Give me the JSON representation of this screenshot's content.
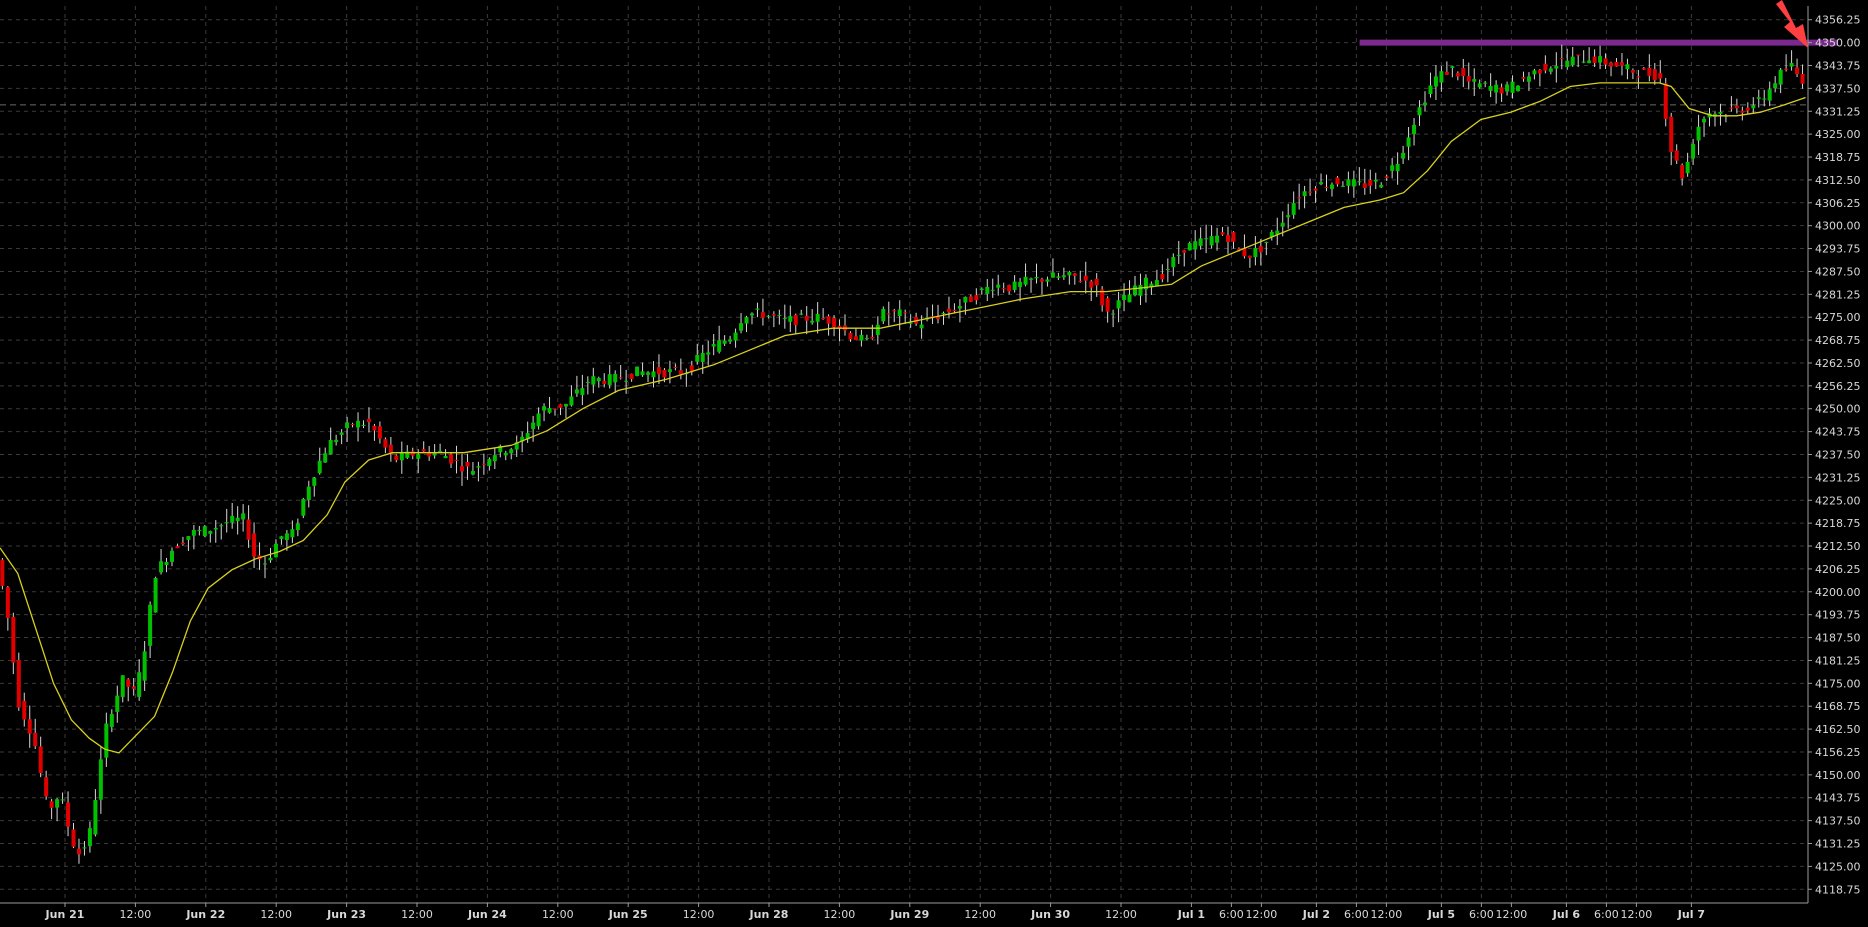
{
  "colors": {
    "background": "#000000",
    "grid": "#3a3a3a",
    "axis": "#9a9a9a",
    "text": "#d8d8d8",
    "up": "#00c000",
    "down": "#e00000",
    "wick": "#d8d8d8",
    "ma": "#d8d020",
    "resistance": "#7a2a8c",
    "arrow": "#ff4040"
  },
  "chart_data": {
    "type": "candlestick",
    "title": "",
    "xlabel": "",
    "ylabel": "",
    "ylim": [
      4115,
      4360
    ],
    "y_ticks": [
      "4356.25",
      "4350.00",
      "4343.75",
      "4337.50",
      "4331.25",
      "4325.00",
      "4318.75",
      "4312.50",
      "4306.25",
      "4300.00",
      "4293.75",
      "4287.50",
      "4281.25",
      "4275.00",
      "4268.75",
      "4262.50",
      "4256.25",
      "4250.00",
      "4243.75",
      "4237.50",
      "4231.25",
      "4225.00",
      "4218.75",
      "4212.50",
      "4206.25",
      "4200.00",
      "4193.75",
      "4187.50",
      "4181.25",
      "4175.00",
      "4168.75",
      "4162.50",
      "4156.25",
      "4150.00",
      "4143.75",
      "4137.50",
      "4131.25",
      "4125.00",
      "4118.75"
    ],
    "x_labels": [
      {
        "t": "Jun 21",
        "bold": true
      },
      {
        "t": "12:00",
        "bold": false
      },
      {
        "t": "Jun 22",
        "bold": true
      },
      {
        "t": "12:00",
        "bold": false
      },
      {
        "t": "Jun 23",
        "bold": true
      },
      {
        "t": "12:00",
        "bold": false
      },
      {
        "t": "Jun 24",
        "bold": true
      },
      {
        "t": "12:00",
        "bold": false
      },
      {
        "t": "Jun 25",
        "bold": true
      },
      {
        "t": "12:00",
        "bold": false
      },
      {
        "t": "Jun 28",
        "bold": true
      },
      {
        "t": "12:00",
        "bold": false
      },
      {
        "t": "Jun 29",
        "bold": true
      },
      {
        "t": "12:00",
        "bold": false
      },
      {
        "t": "Jun 30",
        "bold": true
      },
      {
        "t": "12:00",
        "bold": false
      },
      {
        "t": "Jul 1",
        "bold": true
      },
      {
        "t": "6:00",
        "bold": false
      },
      {
        "t": "12:00",
        "bold": false
      },
      {
        "t": "Jul 2",
        "bold": true
      },
      {
        "t": "6:00",
        "bold": false
      },
      {
        "t": "12:00",
        "bold": false
      },
      {
        "t": "Jul 5",
        "bold": true
      },
      {
        "t": "6:00",
        "bold": false
      },
      {
        "t": "12:00",
        "bold": false
      },
      {
        "t": "Jul 6",
        "bold": true
      },
      {
        "t": "6:00",
        "bold": false
      },
      {
        "t": "12:00",
        "bold": false
      },
      {
        "t": "Jul 7",
        "bold": true
      }
    ],
    "price_path": [
      [
        0,
        4212
      ],
      [
        10,
        4196
      ],
      [
        20,
        4170
      ],
      [
        33,
        4160
      ],
      [
        45,
        4140
      ],
      [
        55,
        4145
      ],
      [
        65,
        4132
      ],
      [
        72,
        4128
      ],
      [
        80,
        4134
      ],
      [
        95,
        4165
      ],
      [
        108,
        4176
      ],
      [
        118,
        4172
      ],
      [
        125,
        4182
      ],
      [
        135,
        4205
      ],
      [
        150,
        4212
      ],
      [
        165,
        4216
      ],
      [
        180,
        4217
      ],
      [
        195,
        4219
      ],
      [
        210,
        4220
      ],
      [
        218,
        4210
      ],
      [
        228,
        4208
      ],
      [
        240,
        4215
      ],
      [
        252,
        4216
      ],
      [
        262,
        4228
      ],
      [
        280,
        4240
      ],
      [
        300,
        4246
      ],
      [
        315,
        4246
      ],
      [
        335,
        4236
      ],
      [
        355,
        4238
      ],
      [
        375,
        4238
      ],
      [
        390,
        4235
      ],
      [
        400,
        4233
      ],
      [
        420,
        4238
      ],
      [
        440,
        4240
      ],
      [
        460,
        4250
      ],
      [
        480,
        4251
      ],
      [
        500,
        4258
      ],
      [
        520,
        4258
      ],
      [
        540,
        4260
      ],
      [
        560,
        4260
      ],
      [
        580,
        4260
      ],
      [
        600,
        4266
      ],
      [
        620,
        4270
      ],
      [
        630,
        4276
      ],
      [
        645,
        4276
      ],
      [
        665,
        4274
      ],
      [
        690,
        4275
      ],
      [
        705,
        4274
      ],
      [
        720,
        4270
      ],
      [
        735,
        4268
      ],
      [
        745,
        4276
      ],
      [
        760,
        4276
      ],
      [
        775,
        4273
      ],
      [
        790,
        4275
      ],
      [
        805,
        4277
      ],
      [
        820,
        4280
      ],
      [
        840,
        4284
      ],
      [
        855,
        4283
      ],
      [
        870,
        4285
      ],
      [
        890,
        4286
      ],
      [
        910,
        4286
      ],
      [
        925,
        4284
      ],
      [
        935,
        4276
      ],
      [
        950,
        4280
      ],
      [
        965,
        4284
      ],
      [
        980,
        4286
      ],
      [
        1000,
        4294
      ],
      [
        1020,
        4296
      ],
      [
        1035,
        4298
      ],
      [
        1045,
        4293
      ],
      [
        1055,
        4292
      ],
      [
        1065,
        4294
      ],
      [
        1080,
        4300
      ],
      [
        1095,
        4308
      ],
      [
        1110,
        4311
      ],
      [
        1130,
        4312
      ],
      [
        1150,
        4311
      ],
      [
        1165,
        4312
      ],
      [
        1180,
        4318
      ],
      [
        1195,
        4330
      ],
      [
        1210,
        4340
      ],
      [
        1225,
        4343
      ],
      [
        1240,
        4339
      ],
      [
        1255,
        4338
      ],
      [
        1270,
        4337
      ],
      [
        1285,
        4340
      ],
      [
        1300,
        4343
      ],
      [
        1320,
        4345
      ],
      [
        1340,
        4346
      ],
      [
        1360,
        4344
      ],
      [
        1380,
        4342
      ],
      [
        1400,
        4341
      ],
      [
        1410,
        4320
      ],
      [
        1420,
        4313
      ],
      [
        1430,
        4326
      ],
      [
        1440,
        4331
      ],
      [
        1455,
        4331
      ],
      [
        1470,
        4332
      ],
      [
        1485,
        4334
      ],
      [
        1500,
        4341
      ],
      [
        1510,
        4344
      ],
      [
        1518,
        4340
      ]
    ],
    "ma_path": [
      [
        0,
        4212
      ],
      [
        15,
        4205
      ],
      [
        30,
        4190
      ],
      [
        45,
        4175
      ],
      [
        60,
        4165
      ],
      [
        75,
        4160
      ],
      [
        88,
        4157
      ],
      [
        100,
        4156
      ],
      [
        115,
        4161
      ],
      [
        130,
        4166
      ],
      [
        145,
        4178
      ],
      [
        160,
        4192
      ],
      [
        175,
        4201
      ],
      [
        195,
        4206
      ],
      [
        215,
        4209
      ],
      [
        235,
        4211
      ],
      [
        255,
        4214
      ],
      [
        275,
        4221
      ],
      [
        290,
        4230
      ],
      [
        310,
        4236
      ],
      [
        330,
        4238
      ],
      [
        355,
        4238
      ],
      [
        390,
        4238
      ],
      [
        430,
        4240
      ],
      [
        460,
        4244
      ],
      [
        490,
        4250
      ],
      [
        520,
        4255
      ],
      [
        560,
        4258
      ],
      [
        600,
        4262
      ],
      [
        630,
        4266
      ],
      [
        660,
        4270
      ],
      [
        700,
        4272
      ],
      [
        740,
        4272
      ],
      [
        770,
        4274
      ],
      [
        800,
        4276
      ],
      [
        830,
        4278
      ],
      [
        860,
        4280
      ],
      [
        900,
        4282
      ],
      [
        930,
        4282
      ],
      [
        960,
        4283
      ],
      [
        985,
        4284
      ],
      [
        1010,
        4289
      ],
      [
        1040,
        4293
      ],
      [
        1070,
        4297
      ],
      [
        1100,
        4301
      ],
      [
        1130,
        4305
      ],
      [
        1160,
        4307
      ],
      [
        1180,
        4309
      ],
      [
        1200,
        4315
      ],
      [
        1220,
        4323
      ],
      [
        1245,
        4329
      ],
      [
        1270,
        4331
      ],
      [
        1295,
        4334
      ],
      [
        1320,
        4338
      ],
      [
        1345,
        4339
      ],
      [
        1370,
        4339
      ],
      [
        1395,
        4339
      ],
      [
        1405,
        4338
      ],
      [
        1420,
        4332
      ],
      [
        1440,
        4330
      ],
      [
        1460,
        4330
      ],
      [
        1480,
        4331
      ],
      [
        1500,
        4333
      ],
      [
        1518,
        4335
      ]
    ],
    "resistance": {
      "value": 4350,
      "x_start": 1143,
      "x_end": 1545
    },
    "series": [
      {
        "type": "candlestick",
        "values": "price_path"
      },
      {
        "type": "line",
        "values": "ma_path"
      },
      {
        "type": "hline",
        "values": "resistance"
      }
    ]
  }
}
